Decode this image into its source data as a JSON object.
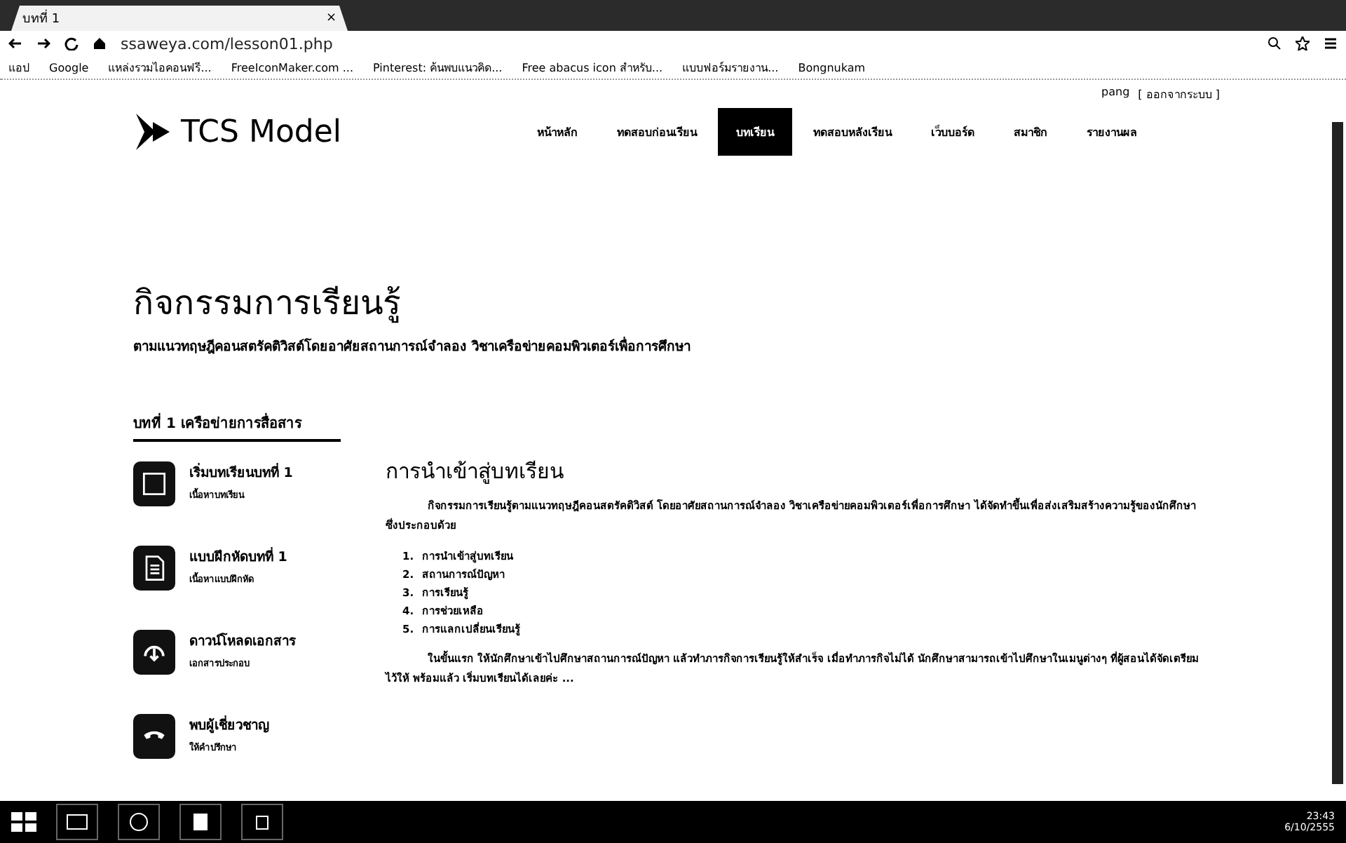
{
  "browser": {
    "tab_title": "บทที่ 1",
    "tab_close": "×",
    "url": "ssaweya.com/lesson01.php",
    "bookmarks": [
      "แอป",
      "Google",
      "แหล่งรวมไอคอนฟรี...",
      "FreeIconMaker.com ...",
      "Pinterest: ค้นพบแนวคิด...",
      "Free abacus icon สำหรับ...",
      "แบบฟอร์มรายงาน...",
      "Bongnukam"
    ]
  },
  "user": {
    "name": "pang",
    "logout": "[ ออกจากระบบ ]"
  },
  "site": {
    "logo": "TCS Model"
  },
  "nav": [
    {
      "label": "หน้าหลัก",
      "selected": false
    },
    {
      "label": "ทดสอบก่อนเรียน",
      "selected": false
    },
    {
      "label": "บทเรียน",
      "selected": true
    },
    {
      "label": "ทดสอบหลังเรียน",
      "selected": false
    },
    {
      "label": "เว็บบอร์ด",
      "selected": false
    },
    {
      "label": "สมาชิก",
      "selected": false
    },
    {
      "label": "รายงานผล",
      "selected": false
    }
  ],
  "page": {
    "title": "กิจกรรมการเรียนรู้",
    "subtitle": "ตามแนวทฤษฎีคอนสตรัคติวิสต์โดยอาศัยสถานการณ์จำลอง วิชาเครือข่ายคอมพิวเตอร์เพื่อการศึกษา"
  },
  "sidebar": {
    "heading": "บทที่ 1 เครือข่ายการสื่อสาร",
    "items": [
      {
        "kind": "book",
        "title": "เริ่มบทเรียนบทที่ 1",
        "caption": "เนื้อหาบทเรียน"
      },
      {
        "kind": "exercise",
        "title": "แบบฝึกหัดบทที่ 1",
        "caption": "เนื้อหาแบบฝึกหัด"
      },
      {
        "kind": "download",
        "title": "ดาวน์โหลดเอกสาร",
        "caption": "เอกสารประกอบ"
      },
      {
        "kind": "phone",
        "title": "พบผู้เชี่ยวชาญ",
        "caption": "ให้คำปรึกษา"
      }
    ]
  },
  "content": {
    "heading": "การนำเข้าสู่บทเรียน",
    "intro": "กิจกรรมการเรียนรู้ตามแนวทฤษฎีคอนสตรัคติวิสต์ โดยอาศัยสถานการณ์จำลอง วิชาเครือข่ายคอมพิวเตอร์เพื่อการศึกษา ได้จัดทำขึ้นเพื่อส่งเสริมสร้างความรู้ของนักศึกษา ซึ่งประกอบด้วย",
    "steps": [
      {
        "num": "1.",
        "text": "การนำเข้าสู่บทเรียน"
      },
      {
        "num": "2.",
        "text": "สถานการณ์ปัญหา"
      },
      {
        "num": "3.",
        "text": "การเรียนรู้"
      },
      {
        "num": "4.",
        "text": "การช่วยเหลือ"
      },
      {
        "num": "5.",
        "text": "การแลกเปลี่ยนเรียนรู้"
      }
    ],
    "outro": "ในขั้นแรก ให้นักศึกษาเข้าไปศึกษาสถานการณ์ปัญหา แล้วทำภารกิจการเรียนรู้ให้สำเร็จ เมื่อทำภารกิจไม่ได้ นักศึกษาสามารถเข้าไปศึกษาในเมนูต่างๆ ที่ผู้สอนได้จัดเตรียมไว้ให้ พร้อมแล้ว เริ่มบทเรียนได้เลยค่ะ ..."
  },
  "taskbar": {
    "time": "23:43",
    "date": "6/10/2555"
  }
}
